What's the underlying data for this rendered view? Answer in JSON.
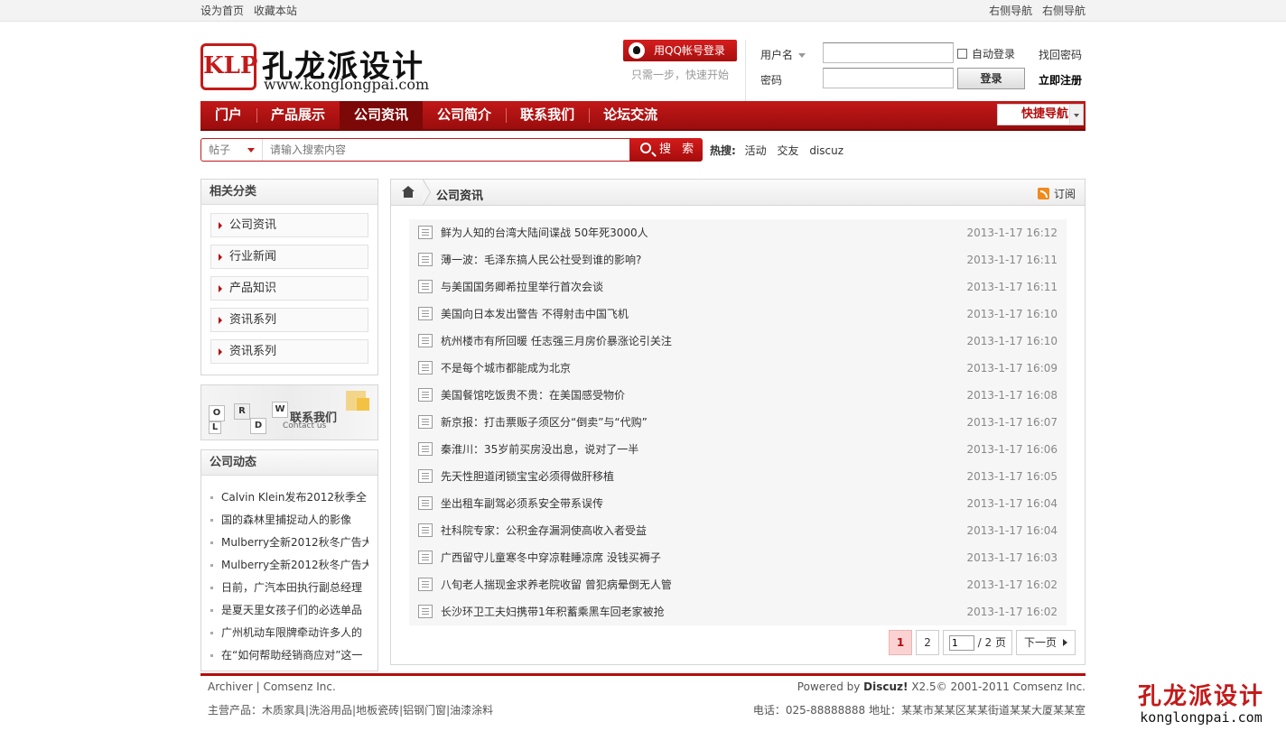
{
  "topbar": {
    "left": [
      "设为首页",
      "收藏本站"
    ],
    "right": [
      "右侧导航",
      "右侧导航"
    ]
  },
  "logo": {
    "mark": "KLP",
    "name": "孔龙派设计",
    "url": "www.konglongpai.com"
  },
  "qq": {
    "button": "用QQ帐号登录",
    "tip": "只需一步，快速开始"
  },
  "login": {
    "username_label": "用户名",
    "password_label": "密码",
    "auto_login": "自动登录",
    "forgot": "找回密码",
    "submit": "登录",
    "register": "立即注册"
  },
  "nav": {
    "items": [
      "门户",
      "产品展示",
      "公司资讯",
      "公司简介",
      "联系我们",
      "论坛交流"
    ],
    "active_index": 2,
    "quick": "快捷导航"
  },
  "search": {
    "type": "帖子",
    "placeholder": "请输入搜索内容",
    "button": "搜 索",
    "hot_label": "热搜:",
    "hot": [
      "活动",
      "交友",
      "discuz"
    ]
  },
  "sidebar": {
    "categories_title": "相关分类",
    "categories": [
      "公司资讯",
      "行业新闻",
      "产品知识",
      "资讯系列",
      "资讯系列"
    ],
    "contact": {
      "title": "联系我们",
      "subtitle": "Contact us",
      "letters": [
        "W",
        "O",
        "R",
        "L",
        "D"
      ]
    },
    "news_title": "公司动态",
    "news": [
      "Calvin Klein发布2012秋季全",
      "国的森林里捕捉动人的影像",
      "Mulberry全新2012秋冬广告大",
      "Mulberry全新2012秋冬广告大",
      "日前，广汽本田执行副总经理",
      "是夏天里女孩子们的必选单品",
      "广州机动车限牌牵动许多人的",
      "在“如何帮助经销商应对”这一"
    ]
  },
  "content": {
    "breadcrumb": "公司资讯",
    "rss": "订阅",
    "articles": [
      {
        "title": "鲜为人知的台湾大陆间谍战 50年死3000人",
        "date": "2013-1-17 16:12"
      },
      {
        "title": "薄一波：毛泽东搞人民公社受到谁的影响?",
        "date": "2013-1-17 16:11"
      },
      {
        "title": "与美国国务卿希拉里举行首次会谈",
        "date": "2013-1-17 16:11"
      },
      {
        "title": "美国向日本发出警告 不得射击中国飞机",
        "date": "2013-1-17 16:10"
      },
      {
        "title": "杭州楼市有所回暖 任志强三月房价暴涨论引关注",
        "date": "2013-1-17 16:10"
      },
      {
        "title": "不是每个城市都能成为北京",
        "date": "2013-1-17 16:09"
      },
      {
        "title": "美国餐馆吃饭贵不贵：在美国感受物价",
        "date": "2013-1-17 16:08"
      },
      {
        "title": "新京报：打击票贩子须区分“倒卖”与“代购”",
        "date": "2013-1-17 16:07"
      },
      {
        "title": "秦淮川：35岁前买房没出息，说对了一半",
        "date": "2013-1-17 16:06"
      },
      {
        "title": "先天性胆道闭锁宝宝必须得做肝移植",
        "date": "2013-1-17 16:05"
      },
      {
        "title": "坐出租车副驾必须系安全带系误传",
        "date": "2013-1-17 16:04"
      },
      {
        "title": "社科院专家：公积金存漏洞使高收入者受益",
        "date": "2013-1-17 16:04"
      },
      {
        "title": "广西留守儿童寒冬中穿凉鞋睡凉席 没钱买褥子",
        "date": "2013-1-17 16:03"
      },
      {
        "title": "八旬老人揣现金求养老院收留 曾犯病晕倒无人管",
        "date": "2013-1-17 16:02"
      },
      {
        "title": "长沙环卫工夫妇携带1年积蓄乘黑车回老家被抢",
        "date": "2013-1-17 16:02"
      }
    ],
    "pager": {
      "pages": [
        "1",
        "2"
      ],
      "current": "1",
      "jump_value": "1",
      "total": "/ 2 页",
      "next": "下一页"
    }
  },
  "footer": {
    "links": "Archiver   | Comsenz Inc.",
    "powered_prefix": "Powered by ",
    "powered_brand": "Discuz!",
    "powered_suffix": " X2.5© 2001-2011 Comsenz Inc.",
    "products": "主营产品：木质家具|洗浴用品|地板瓷砖|铝钢门窗|油漆涂料",
    "contact": "电话：025-88888888 地址：某某市某某区某某街道某某大厦某某室"
  },
  "watermark": {
    "name": "孔龙派设计",
    "domain": "konglongpai.com"
  }
}
